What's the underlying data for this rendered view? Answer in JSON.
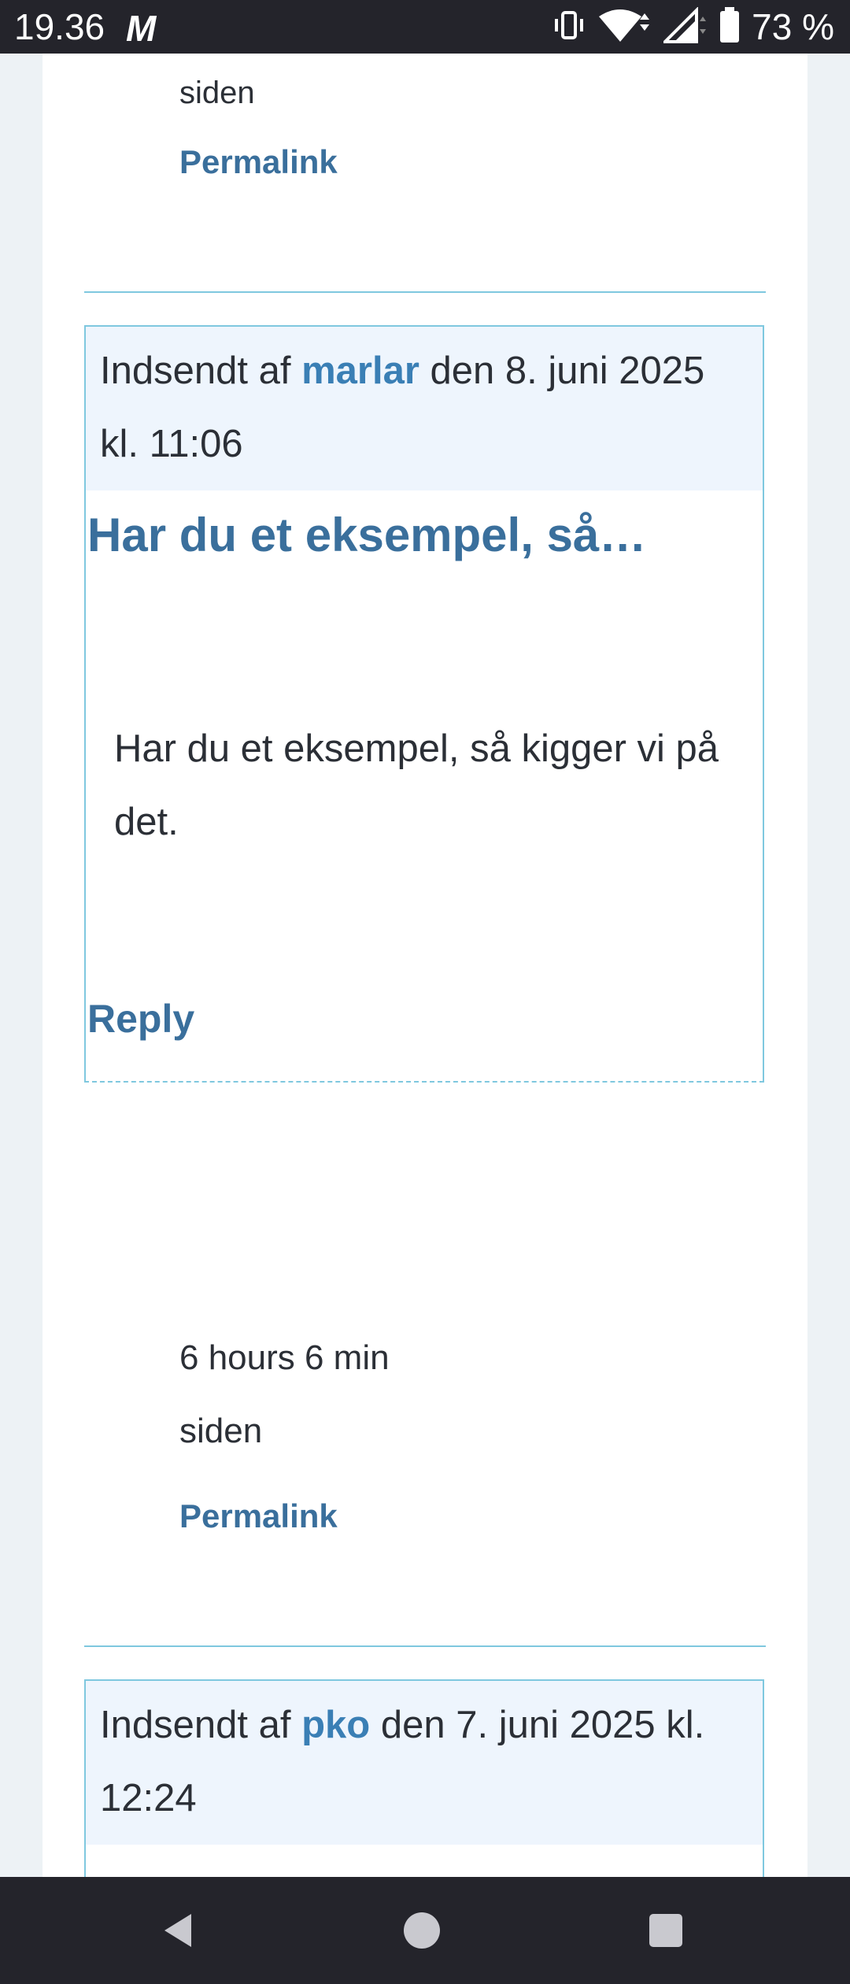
{
  "status_bar": {
    "time": "19.36",
    "notification_icon": "gmail-m-icon",
    "battery_percent": "73 %",
    "icons": [
      "vibrate-icon",
      "wifi-icon",
      "signal-icon",
      "battery-icon"
    ]
  },
  "colors": {
    "link": "#3a6f9c",
    "author": "#3a7fb5",
    "meta_background": "#eef5fd",
    "border": "#7fc8df",
    "system_bar": "#24242b"
  },
  "previous_comment": {
    "siden": "siden",
    "permalink": "Permalink"
  },
  "comment1": {
    "meta_prefix": "Indsendt af",
    "author": "marlar",
    "meta_date": "den 8. juni 2025 kl. 11:06",
    "title": "Har du et eksempel, så…",
    "body": "Har du et eksempel, så kigger vi på det.",
    "reply": "Reply",
    "time_ago": "6 hours 6 min",
    "siden": "siden",
    "permalink": "Permalink"
  },
  "comment2": {
    "meta_prefix": "Indsendt af",
    "author": "pko",
    "meta_date": "den 7. juni 2025 kl. 12:24"
  },
  "nav_bar": {
    "buttons": [
      "back-icon",
      "home-icon",
      "recents-icon"
    ]
  }
}
